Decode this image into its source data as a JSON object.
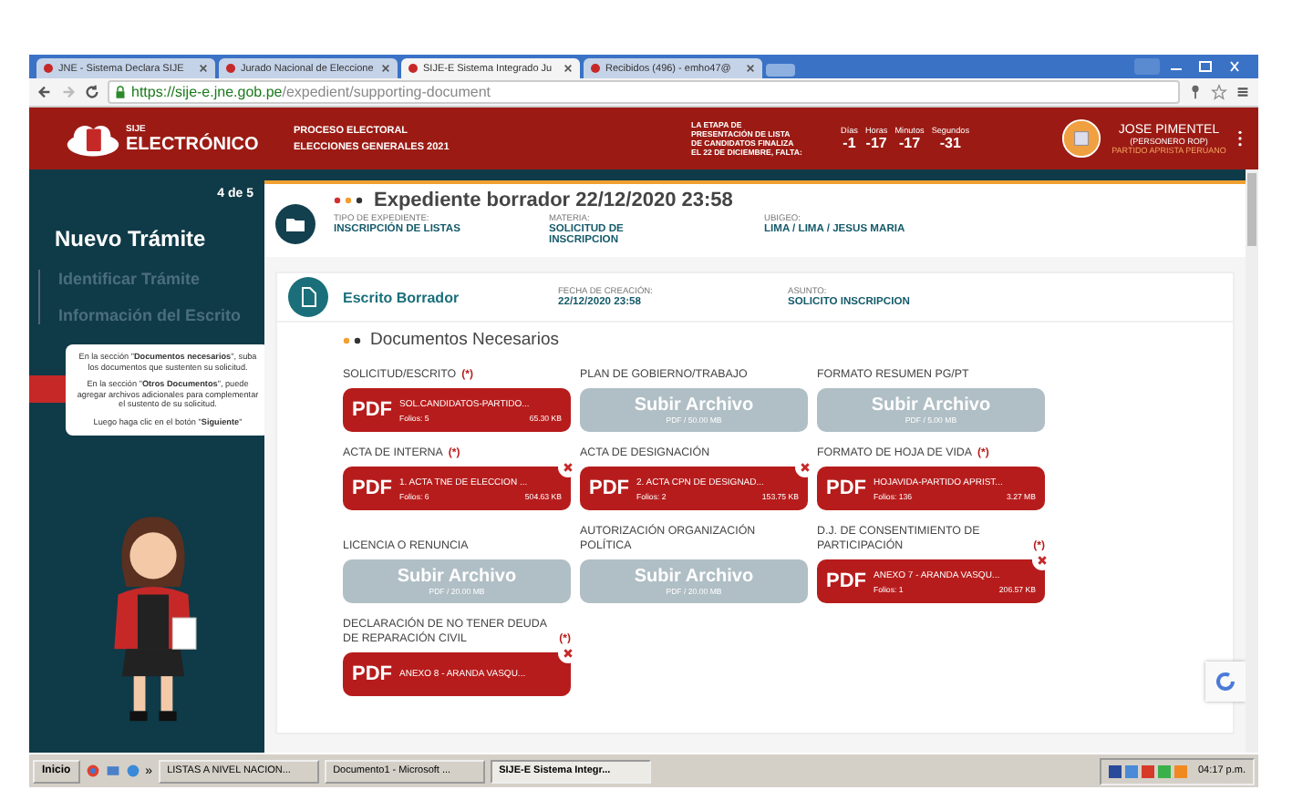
{
  "browser": {
    "tabs": [
      {
        "title": "JNE - Sistema Declara SIJE",
        "selected": false
      },
      {
        "title": "Jurado Nacional de Eleccione",
        "selected": false
      },
      {
        "title": "SIJE-E Sistema Integrado Ju",
        "selected": true
      },
      {
        "title": "Recibidos (496) - emho47@",
        "selected": false
      }
    ],
    "url_host": "https://sije-e.jne.gob.pe",
    "url_path": "/expedient/supporting-document"
  },
  "header": {
    "logo_top": "SIJE",
    "logo_name": "ELECTRÓNICO",
    "process": [
      "PROCESO ELECTORAL",
      "ELECCIONES GENERALES 2021"
    ],
    "stage": [
      "LA ETAPA DE",
      "PRESENTACIÓN DE LISTA",
      "DE CANDIDATOS FINALIZA",
      "EL 22 DE DICIEMBRE, FALTA:"
    ],
    "countdown": [
      {
        "label": "Días",
        "value": "-1"
      },
      {
        "label": "Horas",
        "value": "-17"
      },
      {
        "label": "Minutos",
        "value": "-17"
      },
      {
        "label": "Segundos",
        "value": "-31"
      }
    ],
    "user": {
      "name": "JOSE PIMENTEL",
      "role": "(PERSONERO ROP)",
      "party": "PARTIDO APRISTA PERUANO"
    }
  },
  "sidebar": {
    "step_count": "4 de 5",
    "title": "Nuevo Trámite",
    "steps": [
      "Identificar Trámite",
      "Información del Escrito"
    ],
    "tooltip": [
      "En la sección \"**Documentos necesarios**\", suba los documentos que sustenten su solicitud.",
      "En la sección \"**Otros Documentos**\", puede agregar archivos adicionales para complementar el sustento de su solicitud.",
      "Luego haga clic en el botón \"**Siguiente**\""
    ]
  },
  "expediente": {
    "title": "Expediente borrador 22/12/2020 23:58",
    "fields": [
      {
        "label": "TIPO DE EXPEDIENTE:",
        "value": "INSCRIPCIÓN DE LISTAS"
      },
      {
        "label": "MATERIA:",
        "value": "SOLICITUD DE INSCRIPCION"
      },
      {
        "label": "UBIGEO:",
        "value": "LIMA / LIMA / JESUS MARIA"
      }
    ]
  },
  "escrito": {
    "title": "Escrito Borrador",
    "fields": [
      {
        "label": "FECHA DE CREACIÓN:",
        "value": "22/12/2020 23:58"
      },
      {
        "label": "ASUNTO:",
        "value": "SOLICITO INSCRIPCION"
      }
    ]
  },
  "documents": {
    "title": "Documentos Necesarios",
    "items": [
      {
        "label": "SOLICITUD/ESCRITO",
        "required": true,
        "kind": "file",
        "badge": "PDF",
        "file": "SOL.CANDIDATOS-PARTIDO...",
        "folios": "Folios: 5",
        "size": "65.30 KB",
        "removable": false
      },
      {
        "label": "PLAN DE GOBIERNO/TRABAJO",
        "required": false,
        "kind": "upload",
        "button": "Subir Archivo",
        "hint": "PDF / 50.00 MB"
      },
      {
        "label": "FORMATO RESUMEN PG/PT",
        "required": false,
        "kind": "upload",
        "button": "Subir Archivo",
        "hint": "PDF / 5.00 MB"
      },
      {
        "label": "ACTA DE INTERNA",
        "required": true,
        "kind": "file",
        "badge": "PDF",
        "file": "1. ACTA TNE DE ELECCION ...",
        "folios": "Folios: 6",
        "size": "504.63 KB",
        "removable": true
      },
      {
        "label": "ACTA DE DESIGNACIÓN",
        "required": false,
        "kind": "file",
        "badge": "PDF",
        "file": "2. ACTA CPN DE DESIGNAD...",
        "folios": "Folios: 2",
        "size": "153.75 KB",
        "removable": true
      },
      {
        "label": "FORMATO DE HOJA DE VIDA",
        "required": true,
        "kind": "file",
        "badge": "PDF",
        "file": "HOJAVIDA-PARTIDO APRIST...",
        "folios": "Folios: 136",
        "size": "3.27 MB",
        "removable": false
      },
      {
        "label": "LICENCIA O RENUNCIA",
        "required": false,
        "kind": "upload",
        "button": "Subir Archivo",
        "hint": "PDF / 20.00 MB"
      },
      {
        "label": "AUTORIZACIÓN ORGANIZACIÓN POLÍTICA",
        "required": false,
        "kind": "upload",
        "button": "Subir Archivo",
        "hint": "PDF / 20.00 MB"
      },
      {
        "label": "D.J. DE CONSENTIMIENTO DE PARTICIPACIÓN",
        "required": true,
        "kind": "file",
        "badge": "PDF",
        "file": "ANEXO 7 - ARANDA VASQU...",
        "folios": "Folios: 1",
        "size": "206.57 KB",
        "removable": true
      },
      {
        "label": "DECLARACIÓN DE NO TENER DEUDA DE REPARACIÓN CIVIL",
        "required": true,
        "kind": "file",
        "badge": "PDF",
        "file": "ANEXO 8 - ARANDA VASQU...",
        "removable": true
      }
    ]
  },
  "required_mark": "(*)",
  "taskbar": {
    "start": "Inicio",
    "more": "»",
    "tasks": [
      {
        "title": "LISTAS A NIVEL NACION...",
        "selected": false
      },
      {
        "title": "Documento1 - Microsoft ...",
        "selected": false
      },
      {
        "title": "SIJE-E Sistema Integr...",
        "selected": true
      }
    ],
    "clock": "04:17 p.m."
  }
}
